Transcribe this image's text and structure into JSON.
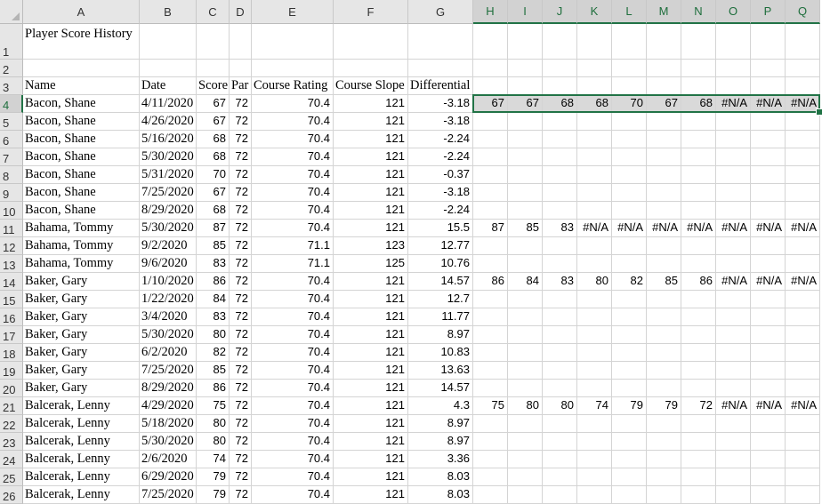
{
  "columns": [
    "A",
    "B",
    "C",
    "D",
    "E",
    "F",
    "G",
    "H",
    "I",
    "J",
    "K",
    "L",
    "M",
    "N",
    "O",
    "P",
    "Q"
  ],
  "rows": [
    {
      "n": "1",
      "cells": [
        "Player Score History",
        "",
        "",
        "",
        "",
        "",
        "",
        "",
        "",
        "",
        "",
        "",
        "",
        "",
        "",
        "",
        ""
      ]
    },
    {
      "n": "2",
      "cells": [
        "",
        "",
        "",
        "",
        "",
        "",
        "",
        "",
        "",
        "",
        "",
        "",
        "",
        "",
        "",
        "",
        ""
      ]
    },
    {
      "n": "3",
      "cells": [
        "Name",
        "Date",
        "Score",
        "Par",
        "Course Rating",
        "Course Slope",
        "Differential",
        "",
        "",
        "",
        "",
        "",
        "",
        "",
        "",
        "",
        ""
      ]
    },
    {
      "n": "4",
      "cells": [
        "Bacon, Shane",
        "4/11/2020",
        "67",
        "72",
        "70.4",
        "121",
        "-3.18",
        "67",
        "67",
        "68",
        "68",
        "70",
        "67",
        "68",
        "#N/A",
        "#N/A",
        "#N/A"
      ]
    },
    {
      "n": "5",
      "cells": [
        "Bacon, Shane",
        "4/26/2020",
        "67",
        "72",
        "70.4",
        "121",
        "-3.18",
        "",
        "",
        "",
        "",
        "",
        "",
        "",
        "",
        "",
        ""
      ]
    },
    {
      "n": "6",
      "cells": [
        "Bacon, Shane",
        "5/16/2020",
        "68",
        "72",
        "70.4",
        "121",
        "-2.24",
        "",
        "",
        "",
        "",
        "",
        "",
        "",
        "",
        "",
        ""
      ]
    },
    {
      "n": "7",
      "cells": [
        "Bacon, Shane",
        "5/30/2020",
        "68",
        "72",
        "70.4",
        "121",
        "-2.24",
        "",
        "",
        "",
        "",
        "",
        "",
        "",
        "",
        "",
        ""
      ]
    },
    {
      "n": "8",
      "cells": [
        "Bacon, Shane",
        "5/31/2020",
        "70",
        "72",
        "70.4",
        "121",
        "-0.37",
        "",
        "",
        "",
        "",
        "",
        "",
        "",
        "",
        "",
        ""
      ]
    },
    {
      "n": "9",
      "cells": [
        "Bacon, Shane",
        "7/25/2020",
        "67",
        "72",
        "70.4",
        "121",
        "-3.18",
        "",
        "",
        "",
        "",
        "",
        "",
        "",
        "",
        "",
        ""
      ]
    },
    {
      "n": "10",
      "cells": [
        "Bacon, Shane",
        "8/29/2020",
        "68",
        "72",
        "70.4",
        "121",
        "-2.24",
        "",
        "",
        "",
        "",
        "",
        "",
        "",
        "",
        "",
        ""
      ]
    },
    {
      "n": "11",
      "cells": [
        "Bahama, Tommy",
        "5/30/2020",
        "87",
        "72",
        "70.4",
        "121",
        "15.5",
        "87",
        "85",
        "83",
        "#N/A",
        "#N/A",
        "#N/A",
        "#N/A",
        "#N/A",
        "#N/A",
        "#N/A"
      ]
    },
    {
      "n": "12",
      "cells": [
        "Bahama, Tommy",
        "9/2/2020",
        "85",
        "72",
        "71.1",
        "123",
        "12.77",
        "",
        "",
        "",
        "",
        "",
        "",
        "",
        "",
        "",
        ""
      ]
    },
    {
      "n": "13",
      "cells": [
        "Bahama, Tommy",
        "9/6/2020",
        "83",
        "72",
        "71.1",
        "125",
        "10.76",
        "",
        "",
        "",
        "",
        "",
        "",
        "",
        "",
        "",
        ""
      ]
    },
    {
      "n": "14",
      "cells": [
        "Baker, Gary",
        "1/10/2020",
        "86",
        "72",
        "70.4",
        "121",
        "14.57",
        "86",
        "84",
        "83",
        "80",
        "82",
        "85",
        "86",
        "#N/A",
        "#N/A",
        "#N/A"
      ]
    },
    {
      "n": "15",
      "cells": [
        "Baker, Gary",
        "1/22/2020",
        "84",
        "72",
        "70.4",
        "121",
        "12.7",
        "",
        "",
        "",
        "",
        "",
        "",
        "",
        "",
        "",
        ""
      ]
    },
    {
      "n": "16",
      "cells": [
        "Baker, Gary",
        "3/4/2020",
        "83",
        "72",
        "70.4",
        "121",
        "11.77",
        "",
        "",
        "",
        "",
        "",
        "",
        "",
        "",
        "",
        ""
      ]
    },
    {
      "n": "17",
      "cells": [
        "Baker, Gary",
        "5/30/2020",
        "80",
        "72",
        "70.4",
        "121",
        "8.97",
        "",
        "",
        "",
        "",
        "",
        "",
        "",
        "",
        "",
        ""
      ]
    },
    {
      "n": "18",
      "cells": [
        "Baker, Gary",
        "6/2/2020",
        "82",
        "72",
        "70.4",
        "121",
        "10.83",
        "",
        "",
        "",
        "",
        "",
        "",
        "",
        "",
        "",
        ""
      ]
    },
    {
      "n": "19",
      "cells": [
        "Baker, Gary",
        "7/25/2020",
        "85",
        "72",
        "70.4",
        "121",
        "13.63",
        "",
        "",
        "",
        "",
        "",
        "",
        "",
        "",
        "",
        ""
      ]
    },
    {
      "n": "20",
      "cells": [
        "Baker, Gary",
        "8/29/2020",
        "86",
        "72",
        "70.4",
        "121",
        "14.57",
        "",
        "",
        "",
        "",
        "",
        "",
        "",
        "",
        "",
        ""
      ]
    },
    {
      "n": "21",
      "cells": [
        "Balcerak, Lenny",
        "4/29/2020",
        "75",
        "72",
        "70.4",
        "121",
        "4.3",
        "75",
        "80",
        "80",
        "74",
        "79",
        "79",
        "72",
        "#N/A",
        "#N/A",
        "#N/A"
      ]
    },
    {
      "n": "22",
      "cells": [
        "Balcerak, Lenny",
        "5/18/2020",
        "80",
        "72",
        "70.4",
        "121",
        "8.97",
        "",
        "",
        "",
        "",
        "",
        "",
        "",
        "",
        "",
        ""
      ]
    },
    {
      "n": "23",
      "cells": [
        "Balcerak, Lenny",
        "5/30/2020",
        "80",
        "72",
        "70.4",
        "121",
        "8.97",
        "",
        "",
        "",
        "",
        "",
        "",
        "",
        "",
        "",
        ""
      ]
    },
    {
      "n": "24",
      "cells": [
        "Balcerak, Lenny",
        "2/6/2020",
        "74",
        "72",
        "70.4",
        "121",
        "3.36",
        "",
        "",
        "",
        "",
        "",
        "",
        "",
        "",
        "",
        ""
      ]
    },
    {
      "n": "25",
      "cells": [
        "Balcerak, Lenny",
        "6/29/2020",
        "79",
        "72",
        "70.4",
        "121",
        "8.03",
        "",
        "",
        "",
        "",
        "",
        "",
        "",
        "",
        "",
        ""
      ]
    },
    {
      "n": "26",
      "cells": [
        "Balcerak, Lenny",
        "7/25/2020",
        "79",
        "72",
        "70.4",
        "121",
        "8.03",
        "",
        "",
        "",
        "",
        "",
        "",
        "",
        "",
        "",
        ""
      ]
    }
  ],
  "selection": {
    "range": "H4:Q4",
    "color": "#217346"
  }
}
